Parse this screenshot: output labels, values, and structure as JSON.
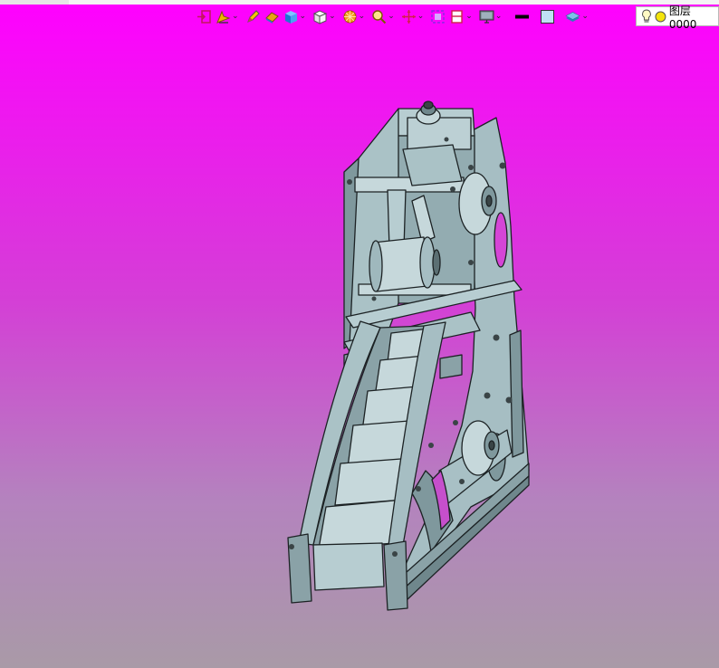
{
  "toolbar": {
    "buttons": [
      {
        "name": "exit-sketch-icon",
        "dropdown": false
      },
      {
        "name": "sketch-tools-icon",
        "dropdown": true
      },
      {
        "name": "pencil-icon",
        "dropdown": false
      },
      {
        "name": "eraser-icon",
        "dropdown": false
      },
      {
        "name": "box-solid-icon",
        "dropdown": true
      },
      {
        "name": "view-cube-icon",
        "dropdown": true
      },
      {
        "name": "render-style-icon",
        "dropdown": true
      },
      {
        "name": "zoom-icon",
        "dropdown": true
      },
      {
        "name": "pan-icon",
        "dropdown": true
      },
      {
        "name": "fit-view-icon",
        "dropdown": false
      },
      {
        "name": "section-view-icon",
        "dropdown": true
      },
      {
        "name": "display-monitor-icon",
        "dropdown": true
      },
      {
        "name": "line-style-icon",
        "dropdown": false
      },
      {
        "name": "color-swatch-icon",
        "dropdown": false
      },
      {
        "name": "layer-stack-icon",
        "dropdown": true
      }
    ]
  },
  "layer": {
    "current": "图层0000",
    "visibility_icon": "lightbulb-icon",
    "status_icon": "yellow-circle-icon",
    "status_color": "#f3e40c"
  },
  "colors": {
    "background_top": "#ff00ff",
    "background_bottom": "#a99aa7",
    "model_fill": "#9fb8bd",
    "model_edge": "#1c2224"
  }
}
